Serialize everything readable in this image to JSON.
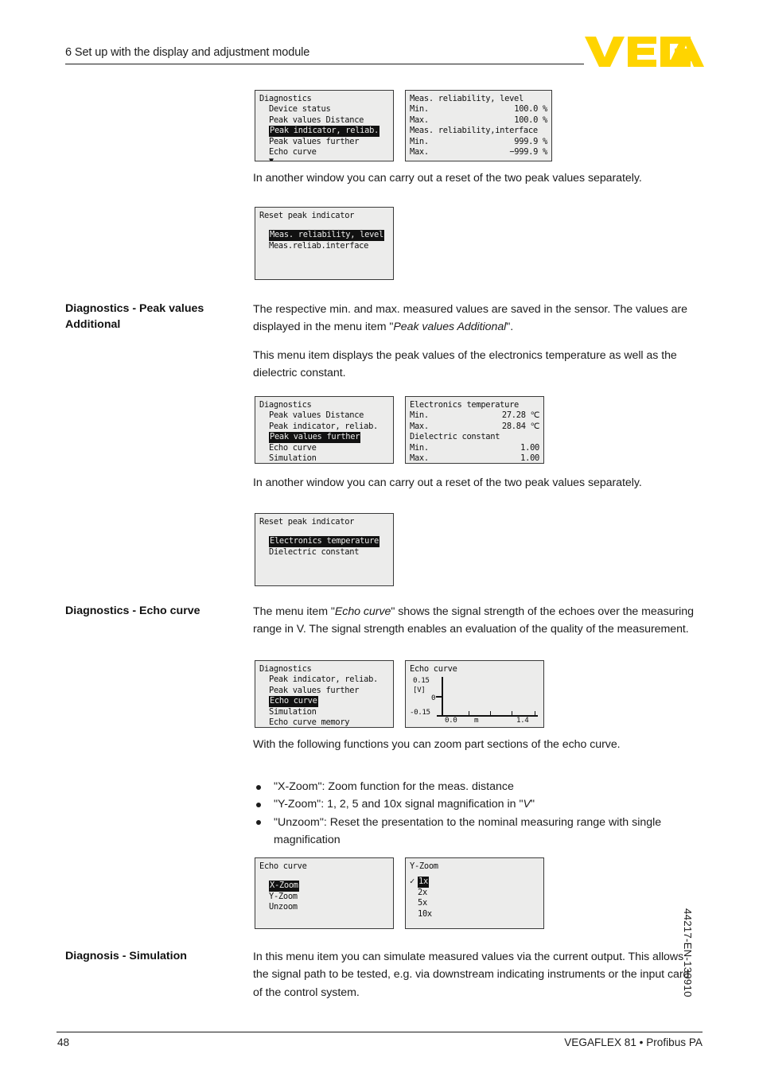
{
  "header": {
    "title": "6 Set up with the display and adjustment module",
    "logo_text": "VEGA",
    "logo_color": "#FFD400"
  },
  "panels": {
    "diag_peak_reliab_menu": {
      "title": "Diagnostics",
      "items": [
        {
          "label": "Device status",
          "selected": false
        },
        {
          "label": "Peak values Distance",
          "selected": false
        },
        {
          "label": "Peak indicator, reliab.",
          "selected": true
        },
        {
          "label": "Peak values further",
          "selected": false
        },
        {
          "label": "Echo curve",
          "selected": false
        }
      ],
      "scroll_indicator": "▼"
    },
    "meas_reliability_values": {
      "group1_title": "Meas. reliability, level",
      "group1_rows": [
        {
          "label": "Min.",
          "value": "100.0 %"
        },
        {
          "label": "Max.",
          "value": "100.0 %"
        }
      ],
      "group2_title": "Meas. reliability,interface",
      "group2_rows": [
        {
          "label": "Min.",
          "value": "999.9 %"
        },
        {
          "label": "Max.",
          "value": "−999.9 %"
        }
      ]
    },
    "reset_peak_reliab": {
      "title": "Reset peak indicator",
      "items": [
        {
          "label": "Meas. reliability, level",
          "selected": true
        },
        {
          "label": "Meas.reliab.interface",
          "selected": false
        }
      ]
    },
    "diag_peak_further_menu": {
      "title": "Diagnostics",
      "items": [
        {
          "label": "Peak values Distance",
          "selected": false
        },
        {
          "label": "Peak indicator, reliab.",
          "selected": false
        },
        {
          "label": "Peak values further",
          "selected": true
        },
        {
          "label": "Echo curve",
          "selected": false
        },
        {
          "label": "Simulation",
          "selected": false
        }
      ],
      "scroll_indicator": "▼"
    },
    "electronics_temperature_values": {
      "group1_title": "Electronics temperature",
      "group1_rows": [
        {
          "label": "Min.",
          "value": "27.28 ℃"
        },
        {
          "label": "Max.",
          "value": "28.84 ℃"
        }
      ],
      "group2_title": "Dielectric constant",
      "group2_rows": [
        {
          "label": "Min.",
          "value": "1.00"
        },
        {
          "label": "Max.",
          "value": "1.00"
        }
      ]
    },
    "reset_peak_additional": {
      "title": "Reset peak indicator",
      "items": [
        {
          "label": "Electronics temperature",
          "selected": true
        },
        {
          "label": "Dielectric constant",
          "selected": false
        }
      ]
    },
    "diag_echo_curve_menu": {
      "title": "Diagnostics",
      "items": [
        {
          "label": "Peak indicator, reliab.",
          "selected": false
        },
        {
          "label": "Peak values further",
          "selected": false
        },
        {
          "label": "Echo curve",
          "selected": true
        },
        {
          "label": "Simulation",
          "selected": false
        },
        {
          "label": "Echo curve memory",
          "selected": false
        }
      ],
      "scroll_indicator": "▼"
    },
    "echo_curve_chart": {
      "title": "Echo curve"
    },
    "echo_curve_zoom_menu": {
      "title": "Echo curve",
      "items": [
        {
          "label": "X-Zoom",
          "selected": true
        },
        {
          "label": "Y-Zoom",
          "selected": false
        },
        {
          "label": "Unzoom",
          "selected": false
        }
      ]
    },
    "y_zoom_menu": {
      "title": "Y-Zoom",
      "check_glyph": "✓",
      "items": [
        {
          "label": "1x",
          "selected": true,
          "checked": true
        },
        {
          "label": "2x",
          "selected": false,
          "checked": false
        },
        {
          "label": "5x",
          "selected": false,
          "checked": false
        },
        {
          "label": "10x",
          "selected": false,
          "checked": false
        }
      ]
    }
  },
  "chart_data": {
    "type": "line",
    "title": "Echo curve",
    "xlabel": "m",
    "ylabel": "[V]",
    "x_tick_labels": [
      "0.0",
      "1.4"
    ],
    "y_tick_labels": [
      "0.15",
      "0",
      "-0.15"
    ],
    "xlim": [
      0.0,
      1.4
    ],
    "ylim": [
      -0.15,
      0.15
    ],
    "grid": false,
    "legend": "none",
    "series": [
      {
        "name": "Echo curve",
        "x": [],
        "values": []
      }
    ]
  },
  "sections": {
    "intro_reset_1": "In another window you can carry out a reset of the two peak values separately.",
    "peak_values_additional": {
      "label": "Diagnostics - Peak values Additional",
      "para1_a": "The respective min. and max. measured values are saved in the sensor. The values are displayed in the menu item \"",
      "para1_em": "Peak values Additional",
      "para1_b": "\".",
      "para2": "This menu item displays the peak values of the electronics temperature as well as the dielectric constant."
    },
    "intro_reset_2": "In another window you can carry out a reset of the two peak values separately.",
    "echo_curve": {
      "label": "Diagnostics - Echo curve",
      "para1_a": "The menu item \"",
      "para1_em": "Echo curve",
      "para1_b": "\" shows the signal strength of the echoes over the measuring range in V. The signal strength enables an evaluation of the quality of the measurement.",
      "para2": "With the following functions you can zoom part sections of the echo curve.",
      "bullets": [
        {
          "text_a": "\"X-Zoom\": Zoom function for the meas. distance",
          "em": "",
          "text_b": ""
        },
        {
          "text_a": "\"Y-Zoom\": 1, 2, 5 and 10x signal magnification in \"",
          "em": "V",
          "text_b": "\""
        },
        {
          "text_a": "\"Unzoom\": Reset the presentation to the nominal measuring range with single magnification",
          "em": "",
          "text_b": ""
        }
      ]
    },
    "simulation": {
      "label": "Diagnosis - Simulation",
      "para1": "In this menu item you can simulate measured values via the current output. This allows the signal path to be tested, e.g. via downstream indicating instruments or the input card of the control system."
    }
  },
  "footer": {
    "page_number": "48",
    "product": "VEGAFLEX 81 • Profibus PA",
    "doc_code": "44217-EN-130910"
  }
}
